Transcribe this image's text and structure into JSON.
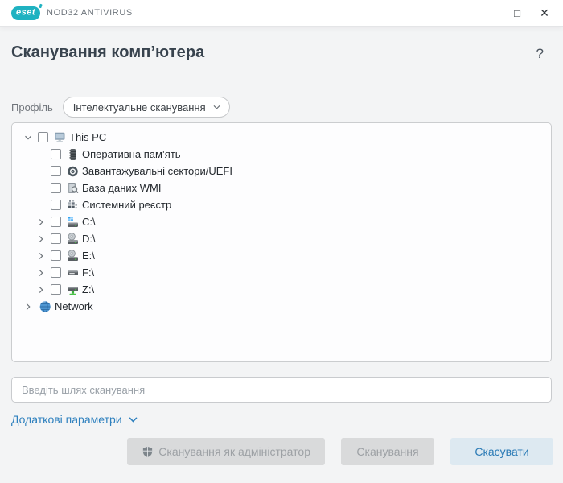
{
  "window": {
    "logo_text": "eset",
    "brand": "NOD32 ANTIVIRUS",
    "minimize_glyph": "□",
    "close_glyph": "✕"
  },
  "header": {
    "title": "Сканування комп’ютера",
    "help_glyph": "?"
  },
  "profile": {
    "label": "Профіль",
    "selected_option": "Інтелектуальне сканування"
  },
  "tree": {
    "items": [
      {
        "label": "This PC",
        "level": 0,
        "expander": "expanded",
        "checkbox": true,
        "checked": false,
        "icon": "computer-icon"
      },
      {
        "label": "Оперативна пам’ять",
        "level": 1,
        "expander": "none",
        "checkbox": true,
        "checked": false,
        "icon": "ram-icon"
      },
      {
        "label": "Завантажувальні сектори/UEFI",
        "level": 1,
        "expander": "none",
        "checkbox": true,
        "checked": false,
        "icon": "boot-sector-icon"
      },
      {
        "label": "База даних WMI",
        "level": 1,
        "expander": "none",
        "checkbox": true,
        "checked": false,
        "icon": "wmi-database-icon"
      },
      {
        "label": "Системний реєстр",
        "level": 1,
        "expander": "none",
        "checkbox": true,
        "checked": false,
        "icon": "registry-icon"
      },
      {
        "label": "C:\\",
        "level": 1,
        "expander": "collapsed",
        "checkbox": true,
        "checked": false,
        "icon": "system-drive-icon"
      },
      {
        "label": "D:\\",
        "level": 1,
        "expander": "collapsed",
        "checkbox": true,
        "checked": false,
        "icon": "optical-drive-icon"
      },
      {
        "label": "E:\\",
        "level": 1,
        "expander": "collapsed",
        "checkbox": true,
        "checked": false,
        "icon": "optical-drive-icon"
      },
      {
        "label": "F:\\",
        "level": 1,
        "expander": "collapsed",
        "checkbox": true,
        "checked": false,
        "icon": "hard-drive-icon"
      },
      {
        "label": "Z:\\",
        "level": 1,
        "expander": "collapsed",
        "checkbox": true,
        "checked": false,
        "icon": "network-drive-icon"
      },
      {
        "label": "Network",
        "level": 0,
        "expander": "collapsed",
        "checkbox": false,
        "checked": false,
        "icon": "network-globe-icon"
      }
    ]
  },
  "path_input": {
    "value": "",
    "placeholder": "Введіть шлях сканування"
  },
  "advanced": {
    "label": "Додаткові параметри"
  },
  "buttons": {
    "scan_as_admin": "Сканування як адміністратор",
    "scan": "Сканування",
    "cancel": "Скасувати"
  },
  "colors": {
    "brand_teal": "#1fb2c1",
    "link_blue": "#2e80be",
    "cancel_bg": "#dde9f1",
    "cancel_text": "#2b7bb6",
    "disabled_bg": "#d9dadb",
    "disabled_text": "#9da1a5",
    "body_bg": "#f3f4f5",
    "panel_bg": "#fdfdfe",
    "led_green": "#45c93e",
    "windows_blue": "#32a5f3"
  }
}
